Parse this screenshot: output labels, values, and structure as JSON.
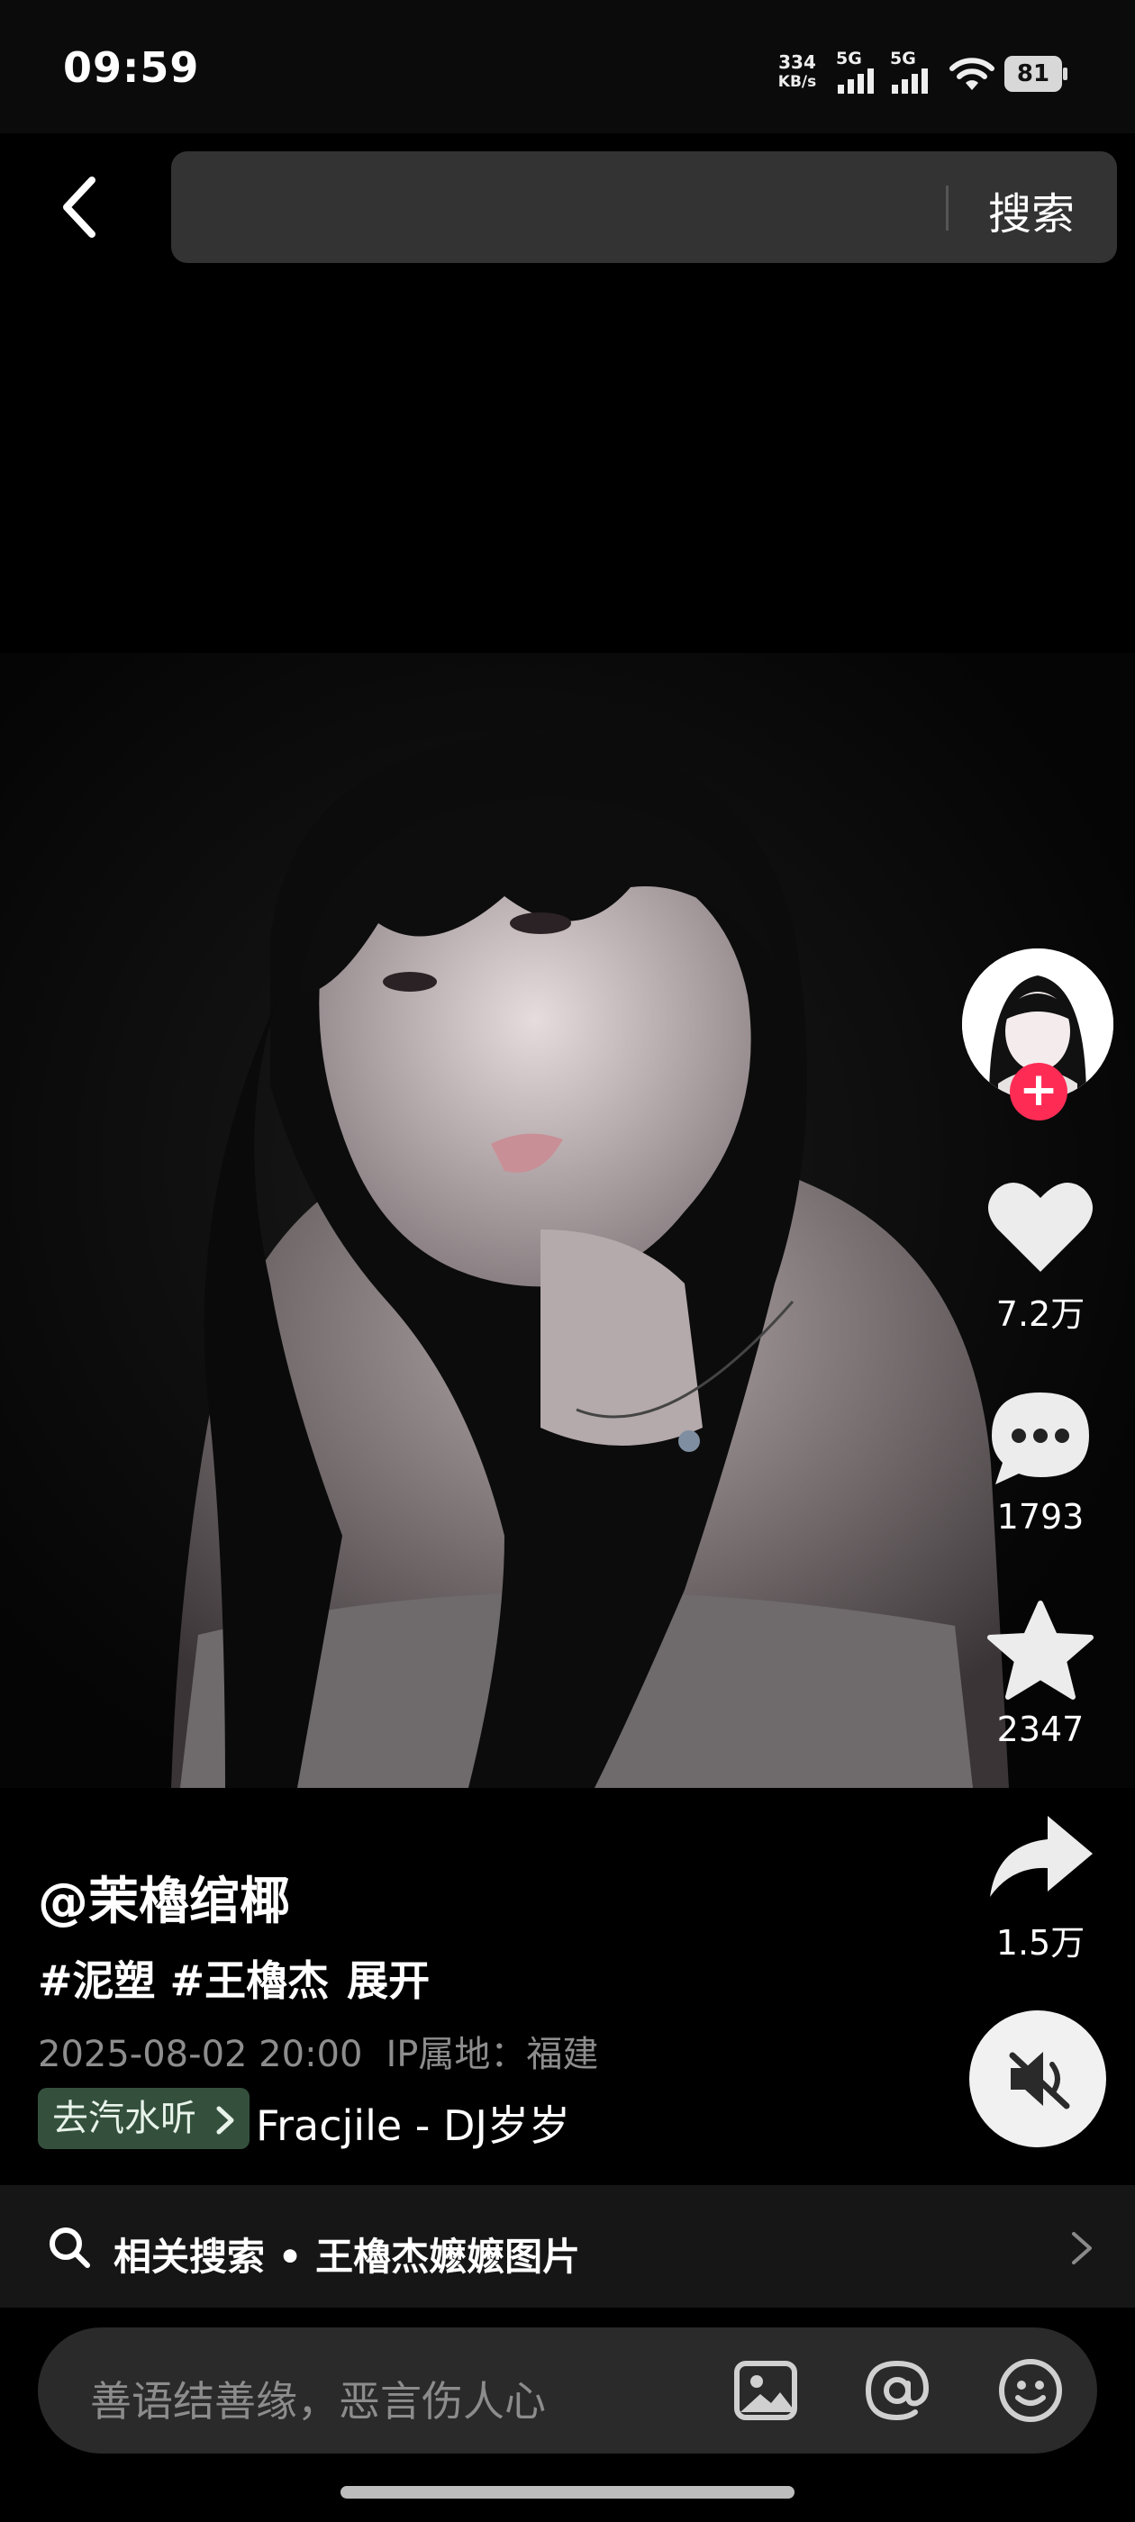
{
  "status_bar": {
    "time": "09:59",
    "net_speed_value": "334",
    "net_speed_unit": "KB/s",
    "sim1_label": "5G",
    "sim2_label": "5G",
    "battery": "81"
  },
  "search": {
    "placeholder": "",
    "button_label": "搜索"
  },
  "post": {
    "author": "@茉櫓绾椰",
    "tags": "#泥塑 #王櫓杰",
    "expand_label": "展开",
    "date": "2025-08-02 20:00",
    "ip_location": "IP属地：福建",
    "music_tag": "去汽水听",
    "music_name": "Fracjile - DJ岁岁"
  },
  "actions": {
    "likes": "7.2万",
    "comments": "1793",
    "favorites": "2347",
    "shares": "1.5万"
  },
  "related": {
    "text": "相关搜索 • 王櫓杰嬷嬷图片"
  },
  "comment_input": {
    "placeholder": "善语结善缘，恶言伤人心"
  },
  "colors": {
    "follow_button": "#fe2c55",
    "music_tag_bg": "#34503d",
    "search_bg": "#333333"
  }
}
